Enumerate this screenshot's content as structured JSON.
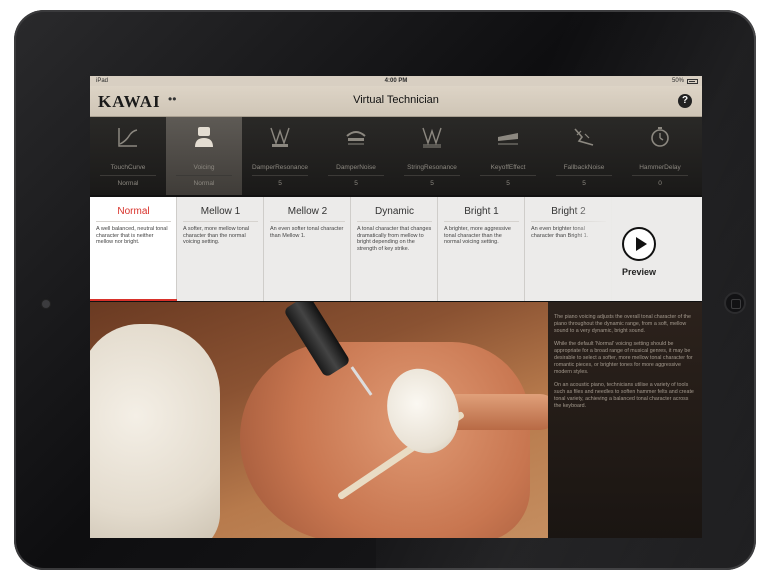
{
  "status_bar": {
    "carrier": "iPad",
    "time": "4:00 PM",
    "battery": "50%"
  },
  "nav": {
    "logo": "KAWAI",
    "menu_glyph": "••",
    "title": "Virtual Technician",
    "help": "?"
  },
  "parameters": [
    {
      "label": "TouchCurve",
      "value": "Normal",
      "icon": "touch-curve-icon"
    },
    {
      "label": "Voicing",
      "value": "Normal",
      "icon": "voicing-icon",
      "selected": true
    },
    {
      "label": "DamperResonance",
      "value": "5",
      "icon": "damper-resonance-icon"
    },
    {
      "label": "DamperNoise",
      "value": "5",
      "icon": "damper-noise-icon"
    },
    {
      "label": "StringResonance",
      "value": "5",
      "icon": "string-resonance-icon"
    },
    {
      "label": "KeyoffEffect",
      "value": "5",
      "icon": "keyoff-effect-icon"
    },
    {
      "label": "FallbackNoise",
      "value": "5",
      "icon": "fallback-noise-icon"
    },
    {
      "label": "HammerDelay",
      "value": "0",
      "icon": "hammer-delay-icon"
    }
  ],
  "voicing_options": [
    {
      "title": "Normal",
      "desc": "A well balanced, neutral tonal character that is neither mellow nor bright.",
      "selected": true
    },
    {
      "title": "Mellow 1",
      "desc": "A softer, more mellow tonal character than the normal voicing setting.",
      "selected": false
    },
    {
      "title": "Mellow 2",
      "desc": "An even softer tonal character than Mellow 1.",
      "selected": false
    },
    {
      "title": "Dynamic",
      "desc": "A tonal character that changes dramatically from mellow to bright depending on the strength of key strike.",
      "selected": false
    },
    {
      "title": "Bright 1",
      "desc": "A brighter, more aggressive tonal character than the normal voicing setting.",
      "selected": false
    },
    {
      "title": "Bright 2",
      "desc": "An even brighter tonal character than Bright 1.",
      "selected": false
    }
  ],
  "preview": {
    "label": "Preview"
  },
  "description": [
    "The piano voicing adjusts the overall tonal character of the piano throughout the dynamic range, from a soft, mellow sound to a very dynamic, bright sound.",
    "While the default 'Normal' voicing setting should be appropriate for a broad range of musical genres, it may be desirable to select a softer, more mellow tonal character for romantic pieces, or brighter tones for more aggressive modern styles.",
    "On an acoustic piano, technicians utilise a variety of tools such as files and needles to soften hammer felts and create tonal variety, achieving a balanced tonal character across the keyboard."
  ],
  "colors": {
    "accent": "#d8312a",
    "toolbar_bg": "#1f1e1c",
    "nav_bg": "#d8cfc2"
  }
}
